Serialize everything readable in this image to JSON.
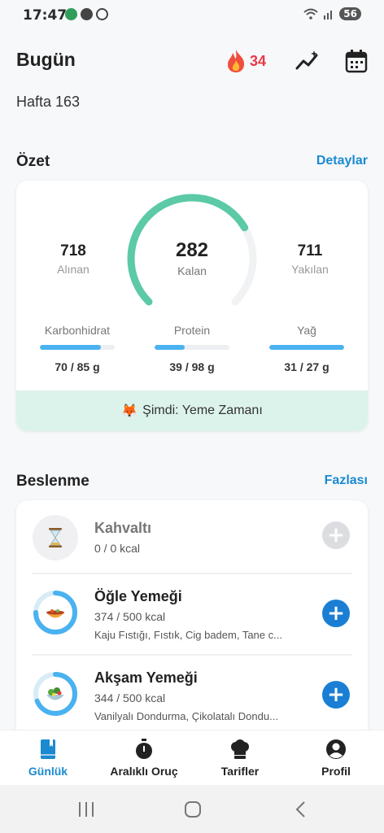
{
  "status": {
    "time": "17:47",
    "battery": "56"
  },
  "header": {
    "title": "Bugün",
    "streak_count": "34",
    "week": "Hafta 163"
  },
  "summary": {
    "section_title": "Özet",
    "details_link": "Detaylar",
    "eaten": {
      "value": "718",
      "label": "Alınan"
    },
    "remaining": {
      "value": "282",
      "label": "Kalan",
      "progress": 0.72
    },
    "burned": {
      "value": "711",
      "label": "Yakılan"
    },
    "macros": [
      {
        "label": "Karbonhidrat",
        "value": "70 / 85 g",
        "fraction": 0.82
      },
      {
        "label": "Protein",
        "value": "39 / 98 g",
        "fraction": 0.4
      },
      {
        "label": "Yağ",
        "value": "31 / 27 g",
        "fraction": 1.0
      }
    ],
    "now_text": "Şimdi: Yeme Zamanı",
    "now_emoji": "🦊"
  },
  "nutrition": {
    "section_title": "Beslenme",
    "more_link": "Fazlası",
    "meals": [
      {
        "name": "Kahvaltı",
        "kcal": "0 / 0 kcal",
        "items": "",
        "progress": 0,
        "icon": "hourglass-icon"
      },
      {
        "name": "Öğle Yemeği",
        "kcal": "374 / 500 kcal",
        "items": "Kaju Fıstığı, Fıstık, Cig badem, Tane c...",
        "progress": 0.75,
        "icon": "lunch-bowl-icon"
      },
      {
        "name": "Akşam Yemeği",
        "kcal": "344 / 500 kcal",
        "items": "Vanilyalı Dondurma, Çikolatalı Dondu...",
        "progress": 0.69,
        "icon": "salad-bowl-icon"
      }
    ]
  },
  "nav": {
    "items": [
      {
        "label": "Günlük",
        "icon": "diary-icon",
        "active": true
      },
      {
        "label": "Aralıklı Oruç",
        "icon": "stopwatch-icon",
        "active": false
      },
      {
        "label": "Tarifler",
        "icon": "chef-hat-icon",
        "active": false
      },
      {
        "label": "Profil",
        "icon": "profile-icon",
        "active": false
      }
    ]
  },
  "colors": {
    "accent": "#1a8ad0",
    "ring": "#5cc9a7",
    "streak": "#e63946",
    "progress": "#4ab2f0"
  }
}
